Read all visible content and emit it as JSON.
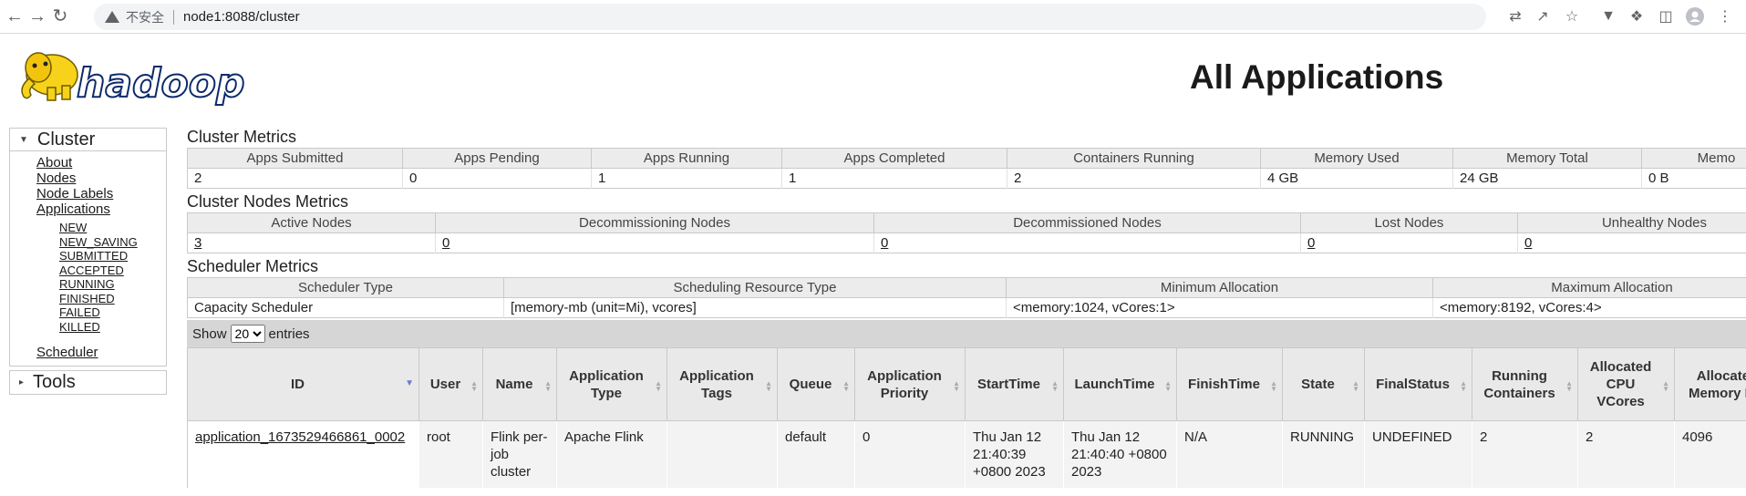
{
  "browser": {
    "security_label": "不安全",
    "url": "node1:8088/cluster"
  },
  "header": {
    "logo_text": "hadoop",
    "title": "All Applications"
  },
  "nav": {
    "cluster": {
      "title": "Cluster",
      "links": [
        "About",
        "Nodes",
        "Node Labels",
        "Applications"
      ],
      "states": [
        "NEW",
        "NEW_SAVING",
        "SUBMITTED",
        "ACCEPTED",
        "RUNNING",
        "FINISHED",
        "FAILED",
        "KILLED"
      ],
      "scheduler": "Scheduler"
    },
    "tools": {
      "title": "Tools"
    }
  },
  "cluster_metrics": {
    "title": "Cluster Metrics",
    "headers": [
      "Apps Submitted",
      "Apps Pending",
      "Apps Running",
      "Apps Completed",
      "Containers Running",
      "Memory Used",
      "Memory Total",
      "Memo"
    ],
    "values": [
      "2",
      "0",
      "1",
      "1",
      "2",
      "4 GB",
      "24 GB",
      "0 B"
    ]
  },
  "node_metrics": {
    "title": "Cluster Nodes Metrics",
    "headers": [
      "Active Nodes",
      "Decommissioning Nodes",
      "Decommissioned Nodes",
      "Lost Nodes",
      "Unhealthy Nodes"
    ],
    "values": [
      "3",
      "0",
      "0",
      "0",
      "0"
    ]
  },
  "scheduler_metrics": {
    "title": "Scheduler Metrics",
    "headers": [
      "Scheduler Type",
      "Scheduling Resource Type",
      "Minimum Allocation",
      "Maximum Allocation"
    ],
    "values": [
      "Capacity Scheduler",
      "[memory-mb (unit=Mi), vcores]",
      "<memory:1024, vCores:1>",
      "<memory:8192, vCores:4>"
    ]
  },
  "show_entries": {
    "prefix": "Show",
    "selected": "20",
    "suffix": "entries"
  },
  "apps_table": {
    "headers": [
      "ID",
      "User",
      "Name",
      "Application Type",
      "Application Tags",
      "Queue",
      "Application Priority",
      "StartTime",
      "LaunchTime",
      "FinishTime",
      "State",
      "FinalStatus",
      "Running Containers",
      "Allocated CPU VCores",
      "Allocated Memory MB"
    ],
    "rows": [
      {
        "id": "application_1673529466861_0002",
        "user": "root",
        "name": "Flink per-job cluster",
        "type": "Apache Flink",
        "tags": "",
        "queue": "default",
        "priority": "0",
        "start": "Thu Jan 12 21:40:39 +0800 2023",
        "launch": "Thu Jan 12 21:40:40 +0800 2023",
        "finish": "N/A",
        "state": "RUNNING",
        "final_status": "UNDEFINED",
        "running_containers": "2",
        "vcores": "2",
        "memory": "4096"
      }
    ]
  }
}
